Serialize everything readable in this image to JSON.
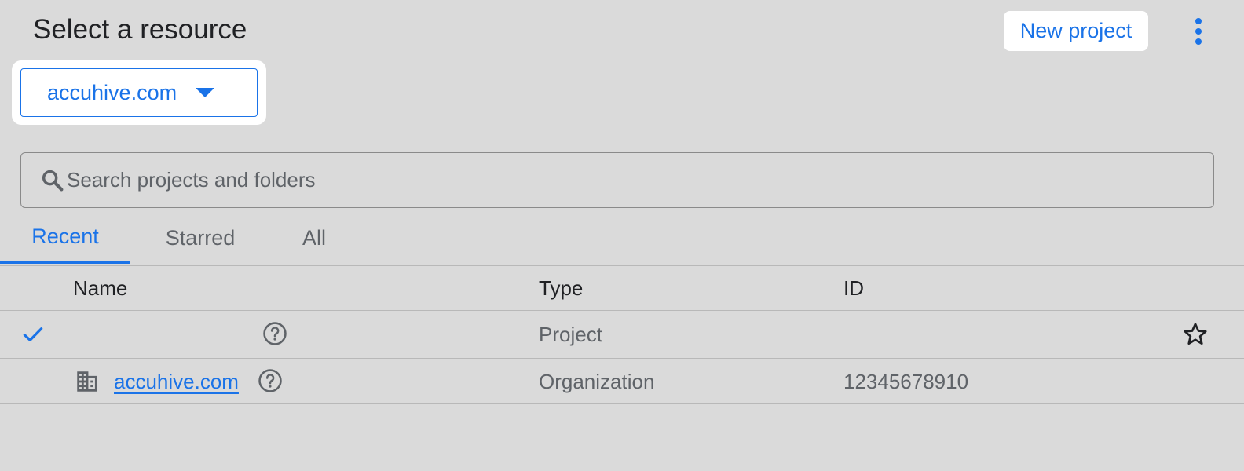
{
  "header": {
    "title": "Select a resource",
    "new_project_label": "New project",
    "more_icon": "more-vert-icon"
  },
  "org_selector": {
    "selected": "accuhive.com",
    "icon": "arrow-drop-down-icon"
  },
  "search": {
    "placeholder": "Search projects and folders",
    "value": "",
    "icon": "search-icon"
  },
  "tabs": [
    {
      "label": "Recent",
      "active": true
    },
    {
      "label": "Starred",
      "active": false
    },
    {
      "label": "All",
      "active": false
    }
  ],
  "table": {
    "columns": [
      "Name",
      "Type",
      "ID"
    ],
    "rows": [
      {
        "selected": true,
        "name": "",
        "type": "Project",
        "id": "",
        "icons": [
          "check-icon",
          "help-icon",
          "star-outline-icon"
        ]
      },
      {
        "selected": false,
        "name": "accuhive.com",
        "type": "Organization",
        "id": "12345678910",
        "icons": [
          "organization-icon",
          "help-icon"
        ]
      }
    ]
  },
  "colors": {
    "accent": "#1a73e8",
    "background": "#dadada",
    "text_primary": "#202124",
    "text_secondary": "#5f6368"
  }
}
